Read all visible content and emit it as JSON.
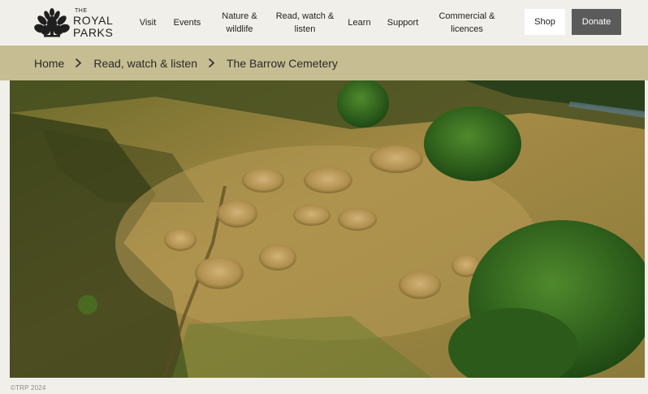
{
  "header": {
    "logo": {
      "small": "THE",
      "line1": "ROYAL",
      "line2": "PARKS"
    },
    "nav": [
      {
        "label": "Visit"
      },
      {
        "label": "Events"
      },
      {
        "label": "Nature & wildlife"
      },
      {
        "label": "Read, watch & listen"
      },
      {
        "label": "Learn"
      },
      {
        "label": "Support"
      },
      {
        "label": "Commercial & licences"
      }
    ],
    "shop_label": "Shop",
    "donate_label": "Donate",
    "colors": {
      "background": "#f1efe9",
      "donate_bg": "#5b5b5b",
      "shop_bg": "#ffffff"
    }
  },
  "breadcrumb": {
    "items": [
      "Home",
      "Read, watch & listen",
      "The Barrow Cemetery"
    ],
    "separator_icon": "chevron-right-icon",
    "background": "#c7bd92"
  },
  "hero": {
    "copyright": "©TRP 2024"
  }
}
